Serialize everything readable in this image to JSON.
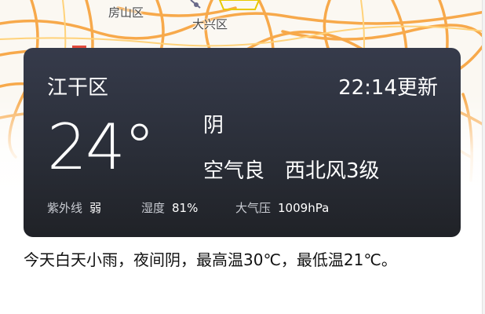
{
  "map": {
    "labels": [
      "房山区",
      "大兴区"
    ]
  },
  "weather": {
    "district": "江干区",
    "updated": "22:14更新",
    "temperature": "24°",
    "condition": "阴",
    "air_quality": "空气良",
    "wind": "西北风3级",
    "stats": [
      {
        "label": "紫外线",
        "value": "弱"
      },
      {
        "label": "湿度",
        "value": "81%"
      },
      {
        "label": "大气压",
        "value": "1009hPa"
      }
    ]
  },
  "summary": "今天白天小雨，夜间阴，最高温30℃，最低温21℃。",
  "colors": {
    "road": "#f7a94b",
    "card_top": "#363b4b",
    "card_bottom": "#202227"
  }
}
